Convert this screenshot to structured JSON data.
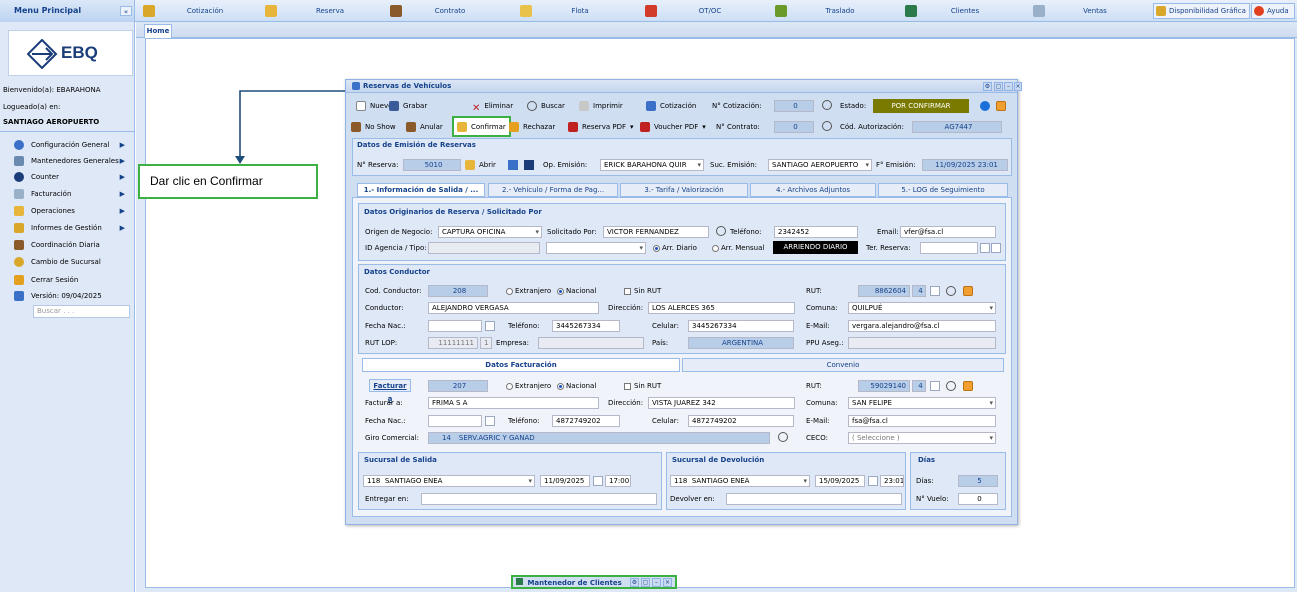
{
  "menu": {
    "title": "Menu Principal",
    "collapse": "«",
    "logo": "EBQ",
    "welcome": "Bienvenido(a): EBARAHONA",
    "logged_label": "Logueado(a) en:",
    "location": "SANTIAGO AEROPUERTO",
    "items": [
      {
        "label": "Configuración General",
        "icon": "gear-icon",
        "arrow": true
      },
      {
        "label": "Mantenedores Generales",
        "icon": "grid-icon",
        "arrow": true
      },
      {
        "label": "Counter",
        "icon": "car-icon",
        "arrow": true
      },
      {
        "label": "Facturación",
        "icon": "invoice-icon",
        "arrow": true
      },
      {
        "label": "Operaciones",
        "icon": "operations-icon",
        "arrow": true
      },
      {
        "label": "Informes de Gestión",
        "icon": "report-icon",
        "arrow": true
      },
      {
        "label": "Coordinación Diaria",
        "icon": "people-icon",
        "arrow": false
      },
      {
        "label": "Cambio de Sucursal",
        "icon": "branch-icon",
        "arrow": false
      },
      {
        "label": "Cerrar Sesión",
        "icon": "lock-icon",
        "arrow": false
      },
      {
        "label": "Versión: 09/04/2025",
        "icon": "version-icon",
        "arrow": false
      }
    ],
    "search_placeholder": "Buscar . . ."
  },
  "topbar": {
    "items": [
      "Cotización",
      "Reserva",
      "Contrato",
      "Flota",
      "OT/OC",
      "Traslado",
      "Clientes",
      "Ventas"
    ],
    "right": [
      "Disponibilidad Gráfica",
      "Ayuda"
    ]
  },
  "tabs": {
    "home": "Home"
  },
  "annotation": {
    "text": "Dar clic en Confirmar"
  },
  "window": {
    "title": "Reservas de Vehículos",
    "toolbar1": [
      "Nuevo",
      "Grabar",
      "Eliminar",
      "Buscar",
      "Imprimir",
      "Cotización"
    ],
    "toolbar2": [
      "No Show",
      "Anular",
      "Confirmar",
      "Rechazar",
      "Reserva PDF",
      "Voucher PDF"
    ],
    "cotizacion_label": "N° Cotización:",
    "cotizacion_value": "0",
    "estado_label": "Estado:",
    "estado_value": "POR CONFIRMAR",
    "contrato_label": "N° Contrato:",
    "contrato_value": "0",
    "autorizacion_label": "Cód. Autorización:",
    "autorizacion_value": "AG7447",
    "emision": {
      "title": "Datos de Emisión de Reservas",
      "reserva_label": "N° Reserva:",
      "reserva_value": "5010",
      "abrir": "Abrir",
      "op_label": "Op. Emisión:",
      "op_value": "ERICK BARAHONA QUIR",
      "suc_label": "Suc. Emisión:",
      "suc_value": "SANTIAGO AEROPUERTO",
      "fecha_label": "F° Emisión:",
      "fecha_value": "11/09/2025 23:01"
    },
    "tabs": [
      "1.- Información de Salida / ...",
      "2.- Vehículo / Forma de Pag...",
      "3.- Tarifa / Valorización",
      "4.- Archivos Adjuntos",
      "5.- LOG de Seguimiento"
    ],
    "origen": {
      "title": "Datos Originarios de Reserva / Solicitado Por",
      "origen_label": "Origen de Negocio:",
      "origen_value": "CAPTURA OFICINA",
      "solicitado_label": "Solicitado Por:",
      "solicitado_value": "VICTOR FERNANDEZ",
      "telefono_label": "Teléfono:",
      "telefono_value": "2342452",
      "email_label": "Email:",
      "email_value": "vfer@fsa.cl",
      "agencia_label": "ID Agencia / Tipo:",
      "arr_diario": "Arr. Diario",
      "arr_mensual": "Arr. Mensual",
      "arriendo_value": "ARRIENDO DIARIO",
      "ter_label": "Ter. Reserva:"
    },
    "conductor": {
      "title": "Datos Conductor",
      "cod_label": "Cod. Conductor:",
      "cod_value": "208",
      "extranjero": "Extranjero",
      "nacional": "Nacional",
      "sin_rut": "Sin RUT",
      "rut_label": "RUT:",
      "rut_value": "8862604",
      "rut_dv": "4",
      "conductor_label": "Conductor:",
      "conductor_value": "ALEJANDRO VERGASA",
      "direccion_label": "Dirección:",
      "direccion_value": "LOS ALERCES 365",
      "comuna_label": "Comuna:",
      "comuna_value": "QUILPUÉ",
      "fecha_label": "Fecha Nac.:",
      "telefono_label": "Teléfono:",
      "telefono_value": "3445267334",
      "celular_label": "Celular:",
      "celular_value": "3445267334",
      "email_label": "E-Mail:",
      "email_value": "vergara.alejandro@fsa.cl",
      "rutlop_label": "RUT LOP:",
      "rutlop_value": "11111111",
      "rutlop_dv": "1",
      "empresa_label": "Empresa:",
      "pais_label": "País:",
      "pais_value": "ARGENTINA",
      "ppu_label": "PPU Aseg.:"
    },
    "factura_tabs": [
      "Datos Facturación",
      "Convenio"
    ],
    "factura": {
      "facturar_btn": "Facturar a",
      "cod_value": "207",
      "extranjero": "Extranjero",
      "nacional": "Nacional",
      "sin_rut": "Sin RUT",
      "rut_label": "RUT:",
      "rut_value": "59029140",
      "rut_dv": "4",
      "facturar_label": "Facturar a:",
      "facturar_value": "FRIMA S A",
      "direccion_label": "Dirección:",
      "direccion_value": "VISTA JUAREZ 342",
      "comuna_label": "Comuna:",
      "comuna_value": "SAN FELIPE",
      "fecha_label": "Fecha Nac.:",
      "telefono_label": "Teléfono:",
      "telefono_value": "4872749202",
      "celular_label": "Celular:",
      "celular_value": "4872749202",
      "email_label": "E-Mail:",
      "email_value": "fsa@fsa.cl",
      "giro_label": "Giro Comercial:",
      "giro_code": "14",
      "giro_value": "SERV.AGRIC Y GANAD",
      "ceco_label": "CECO:",
      "ceco_value": "( Seleccione )"
    },
    "salida": {
      "title": "Sucursal de Salida",
      "code": "118",
      "name": "SANTIAGO ENEA",
      "fecha": "11/09/2025",
      "hora": "17:00",
      "entregar_label": "Entregar en:"
    },
    "devolucion": {
      "title": "Sucursal de Devolución",
      "code": "118",
      "name": "SANTIAGO ENEA",
      "fecha": "15/09/2025",
      "hora": "23:01",
      "devolver_label": "Devolver en:"
    },
    "dias": {
      "title": "Días",
      "dias_label": "Días:",
      "dias_value": "5",
      "vuelo_label": "N° Vuelo:",
      "vuelo_value": "0"
    }
  },
  "minimized": {
    "title": "Mantenedor de Clientes"
  },
  "colors": {
    "accent": "#15428b",
    "highlight_green": "#3cb043",
    "estado_bg": "#7a7a00",
    "arrow": "#1f4f7a"
  }
}
